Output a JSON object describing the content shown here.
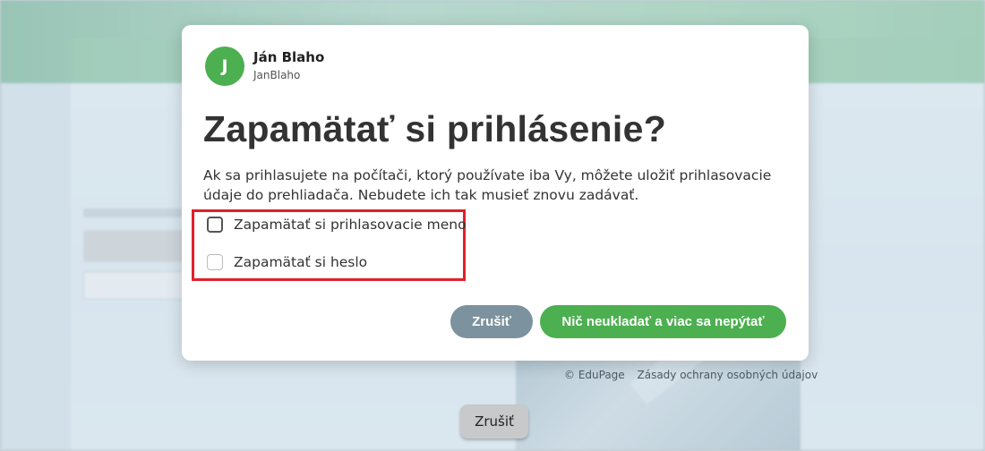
{
  "background": {
    "cancel_label": "Zrušiť",
    "footer": {
      "copyright": "© EduPage",
      "privacy_link": "Zásady ochrany osobných údajov"
    }
  },
  "dialog": {
    "user": {
      "initial": "J",
      "name": "Ján Blaho",
      "login": "JanBlaho"
    },
    "title": "Zapamätať si prihlásenie?",
    "description": "Ak sa prihlasujete na počítači, ktorý používate iba Vy, môžete uložiť prihlasovacie údaje do prehliadača. Nebudete ich tak musieť znovu zadávať.",
    "options": [
      {
        "label": "Zapamätať si prihlasovacie meno",
        "checked": false
      },
      {
        "label": "Zapamätať si heslo",
        "checked": false,
        "disabled": true
      }
    ],
    "buttons": {
      "cancel": "Zrušiť",
      "never": "Nič neukladať a viac sa nepýtať"
    }
  },
  "colors": {
    "accent_green": "#4caf50",
    "cancel_gray": "#7c929e",
    "highlight_red": "#e0202a"
  }
}
